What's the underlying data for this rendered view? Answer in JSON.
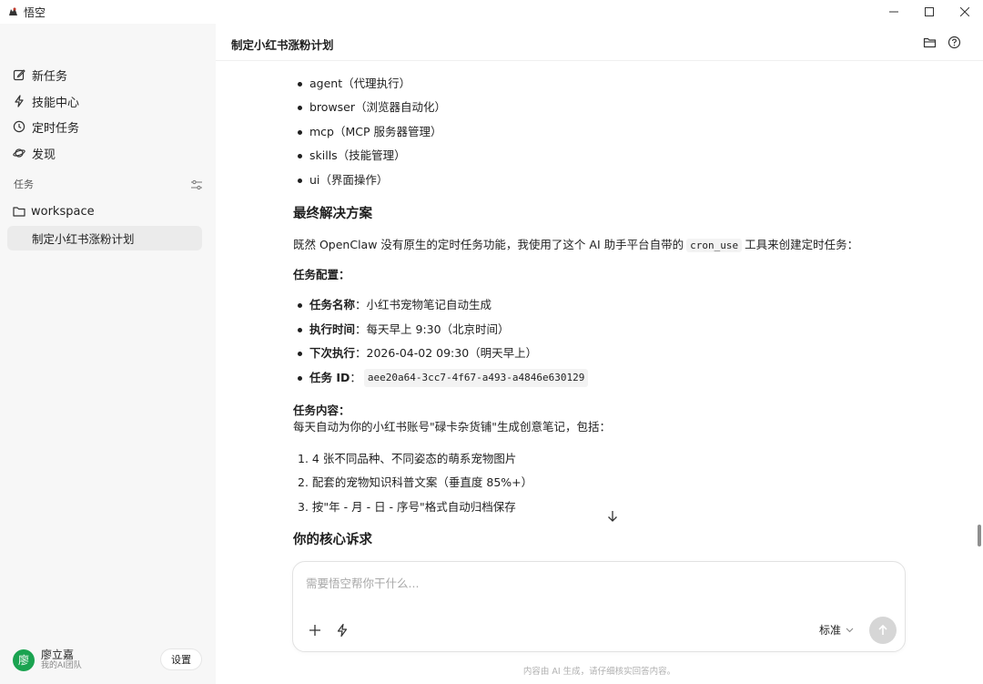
{
  "window": {
    "title": "悟空"
  },
  "sidebar": {
    "nav": [
      {
        "label": "新任务",
        "icon": "edit-icon"
      },
      {
        "label": "技能中心",
        "icon": "lightning-icon"
      },
      {
        "label": "定时任务",
        "icon": "clock-icon"
      },
      {
        "label": "发现",
        "icon": "planet-icon"
      }
    ],
    "section_label": "任务",
    "folder": "workspace",
    "active_task": "制定小红书涨粉计划",
    "user": {
      "name": "廖立嘉",
      "sub": "我的AI团队",
      "avatar_char": "廖"
    },
    "settings_label": "设置"
  },
  "main": {
    "title": "制定小红书涨粉计划",
    "top_bullets": [
      "agent（代理执行）",
      "browser（浏览器自动化）",
      "mcp（MCP 服务器管理）",
      "skills（技能管理）",
      "ui（界面操作）"
    ],
    "heading_final": "最终解决方案",
    "intro_pre": "既然 OpenClaw 没有原生的定时任务功能，我使用了这个 AI 助手平台自带的",
    "intro_code": "cron_use",
    "intro_post": "工具来创建定时任务：",
    "config_label": "任务配置：",
    "config_items": [
      {
        "key": "任务名称",
        "value": "：小红书宠物笔记自动生成"
      },
      {
        "key": "执行时间",
        "value": "：每天早上 9:30（北京时间）"
      },
      {
        "key": "下次执行",
        "value": "：2026-04-02 09:30（明天早上）"
      },
      {
        "key": "任务 ID",
        "value": "：",
        "code": "aee20a64-3cc7-4f67-a493-a4846e630129"
      }
    ],
    "content_label": "任务内容：",
    "content_desc": "每天自动为你的小红书账号\"碌卡杂货铺\"生成创意笔记，包括：",
    "content_items": [
      "1. 4 张不同品种、不同姿态的萌系宠物图片",
      "2. 配套的宠物知识科普文案（垂直度 85%+）",
      "3. 按\"年 - 月 - 日 - 序号\"格式自动归档保存"
    ],
    "heading_core": "你的核心诉求"
  },
  "input": {
    "placeholder": "需要悟空帮你干什么...",
    "value": "",
    "mode": "标准"
  },
  "disclaimer": "内容由 AI 生成，请仔细核实回答内容。",
  "colors": {
    "sidebar_bg": "#f7f7f7",
    "active_item_bg": "#ebebeb",
    "avatar_green": "#1aa350",
    "send_disabled": "#d6d6d6"
  }
}
